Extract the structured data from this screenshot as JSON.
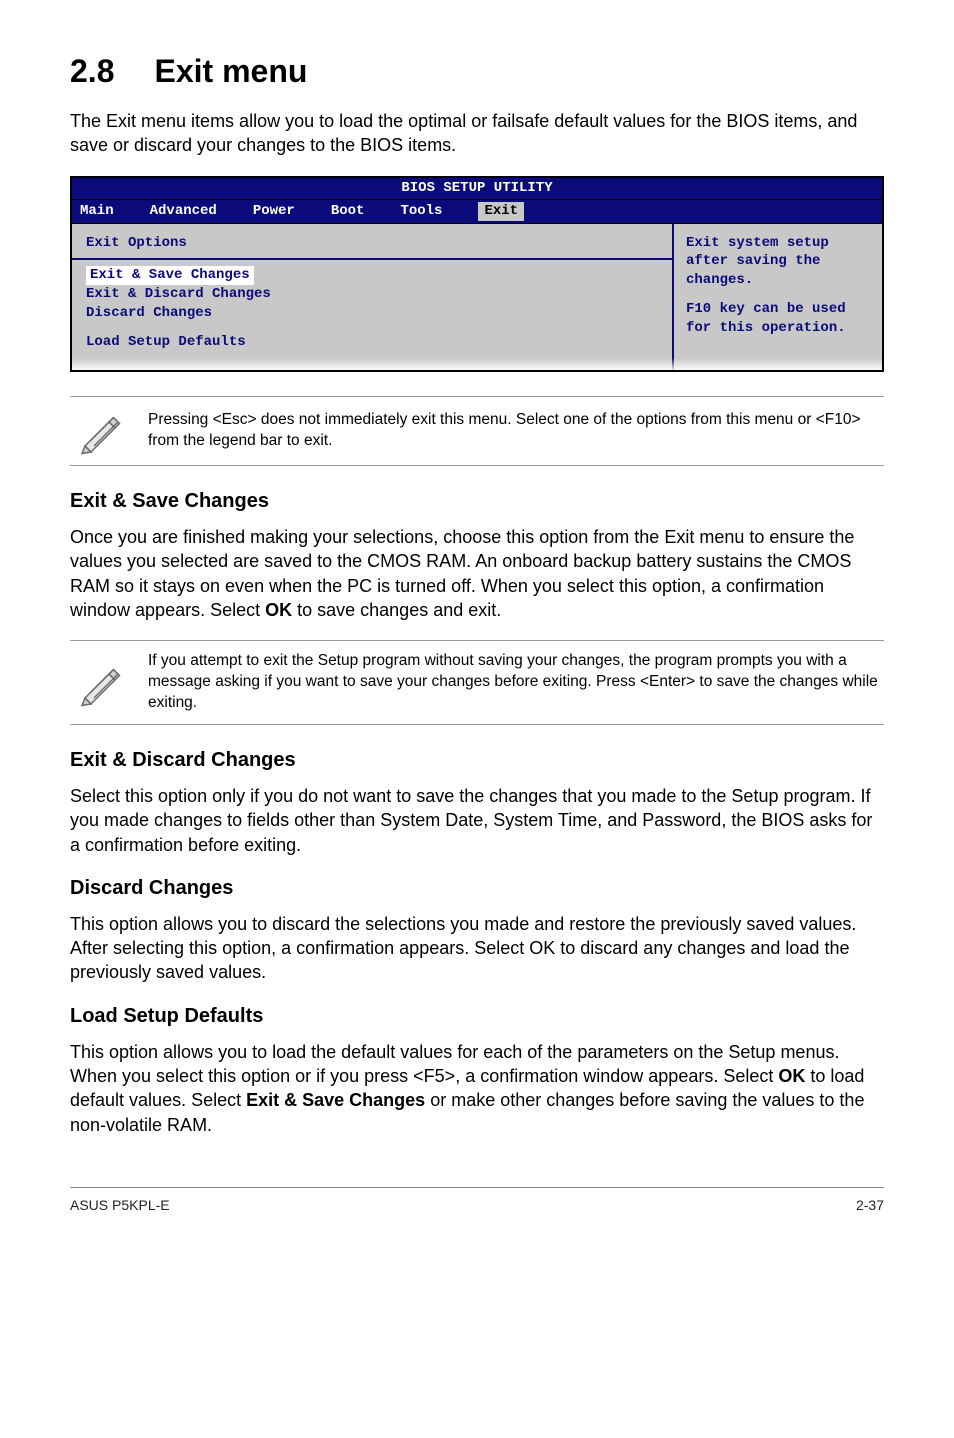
{
  "section": {
    "number": "2.8",
    "title": "Exit menu"
  },
  "intro": "The Exit menu items allow you to load the optimal or failsafe default values for the BIOS items, and save or discard your changes to the BIOS items.",
  "bios": {
    "utility_title": "BIOS SETUP UTILITY",
    "tabs": {
      "main": "Main",
      "advanced": "Advanced",
      "power": "Power",
      "boot": "Boot",
      "tools": "Tools",
      "exit": "Exit"
    },
    "left": {
      "heading": "Exit Options",
      "items": {
        "save": "Exit & Save Changes",
        "discard_exit": "Exit & Discard Changes",
        "discard": "Discard Changes",
        "defaults": "Load Setup Defaults"
      }
    },
    "right": {
      "line1": "Exit system setup",
      "line2": "after saving the",
      "line3": "changes.",
      "line4": "F10 key can be used",
      "line5": "for this operation."
    }
  },
  "note1": "Pressing <Esc> does not immediately exit this menu. Select one of the options from this menu or <F10> from the legend bar to exit.",
  "exit_save": {
    "heading": "Exit & Save Changes",
    "p1a": "Once you are finished making your selections, choose this option from the Exit menu to ensure the values you selected are saved to the CMOS RAM. An onboard backup battery sustains the CMOS RAM so it stays on even when the PC is turned off. When you select this option, a confirmation window appears. Select ",
    "ok": "OK",
    "p1b": " to save changes and exit."
  },
  "note2": " If you attempt to exit the Setup program without saving your changes, the program prompts you with a message asking if you want to save your changes before exiting. Press <Enter>  to save the  changes while exiting.",
  "exit_discard": {
    "heading": "Exit & Discard Changes",
    "p": "Select this option only if you do not want to save the changes that you  made to the Setup program. If you made changes to fields other than System Date, System Time, and Password, the BIOS asks for a confirmation before exiting."
  },
  "discard": {
    "heading": "Discard Changes",
    "p1": "This option allows you to discard the selections you made and restore the previously saved values. After selecting this option, a confirmation appears. Select ",
    "ok": "OK",
    "p2": " to discard any changes and load the previously saved values."
  },
  "defaults": {
    "heading": "Load Setup Defaults",
    "p1": "This option allows you to load the default values for each of the parameters on the Setup menus. When you select this option or if you press <F5>, a confirmation window appears. Select ",
    "ok": "OK",
    "p2": " to load default values. Select ",
    "esc": "Exit & Save Changes",
    "p3": " or make other changes before saving the values to the non-volatile RAM."
  },
  "footer": {
    "left": "ASUS P5KPL-E",
    "right": "2-37"
  }
}
